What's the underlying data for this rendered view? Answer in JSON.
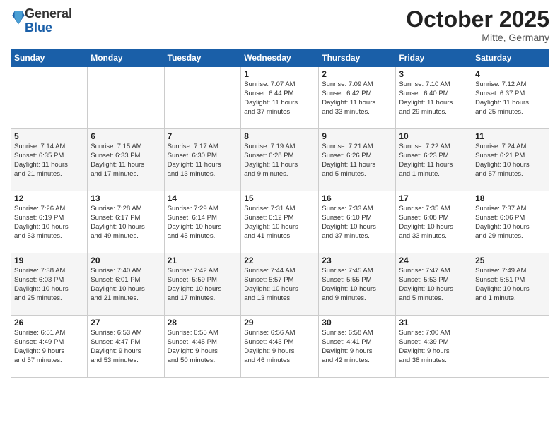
{
  "logo": {
    "general": "General",
    "blue": "Blue"
  },
  "header": {
    "month": "October 2025",
    "location": "Mitte, Germany"
  },
  "weekdays": [
    "Sunday",
    "Monday",
    "Tuesday",
    "Wednesday",
    "Thursday",
    "Friday",
    "Saturday"
  ],
  "weeks": [
    [
      {
        "day": "",
        "info": ""
      },
      {
        "day": "",
        "info": ""
      },
      {
        "day": "",
        "info": ""
      },
      {
        "day": "1",
        "info": "Sunrise: 7:07 AM\nSunset: 6:44 PM\nDaylight: 11 hours\nand 37 minutes."
      },
      {
        "day": "2",
        "info": "Sunrise: 7:09 AM\nSunset: 6:42 PM\nDaylight: 11 hours\nand 33 minutes."
      },
      {
        "day": "3",
        "info": "Sunrise: 7:10 AM\nSunset: 6:40 PM\nDaylight: 11 hours\nand 29 minutes."
      },
      {
        "day": "4",
        "info": "Sunrise: 7:12 AM\nSunset: 6:37 PM\nDaylight: 11 hours\nand 25 minutes."
      }
    ],
    [
      {
        "day": "5",
        "info": "Sunrise: 7:14 AM\nSunset: 6:35 PM\nDaylight: 11 hours\nand 21 minutes."
      },
      {
        "day": "6",
        "info": "Sunrise: 7:15 AM\nSunset: 6:33 PM\nDaylight: 11 hours\nand 17 minutes."
      },
      {
        "day": "7",
        "info": "Sunrise: 7:17 AM\nSunset: 6:30 PM\nDaylight: 11 hours\nand 13 minutes."
      },
      {
        "day": "8",
        "info": "Sunrise: 7:19 AM\nSunset: 6:28 PM\nDaylight: 11 hours\nand 9 minutes."
      },
      {
        "day": "9",
        "info": "Sunrise: 7:21 AM\nSunset: 6:26 PM\nDaylight: 11 hours\nand 5 minutes."
      },
      {
        "day": "10",
        "info": "Sunrise: 7:22 AM\nSunset: 6:23 PM\nDaylight: 11 hours\nand 1 minute."
      },
      {
        "day": "11",
        "info": "Sunrise: 7:24 AM\nSunset: 6:21 PM\nDaylight: 10 hours\nand 57 minutes."
      }
    ],
    [
      {
        "day": "12",
        "info": "Sunrise: 7:26 AM\nSunset: 6:19 PM\nDaylight: 10 hours\nand 53 minutes."
      },
      {
        "day": "13",
        "info": "Sunrise: 7:28 AM\nSunset: 6:17 PM\nDaylight: 10 hours\nand 49 minutes."
      },
      {
        "day": "14",
        "info": "Sunrise: 7:29 AM\nSunset: 6:14 PM\nDaylight: 10 hours\nand 45 minutes."
      },
      {
        "day": "15",
        "info": "Sunrise: 7:31 AM\nSunset: 6:12 PM\nDaylight: 10 hours\nand 41 minutes."
      },
      {
        "day": "16",
        "info": "Sunrise: 7:33 AM\nSunset: 6:10 PM\nDaylight: 10 hours\nand 37 minutes."
      },
      {
        "day": "17",
        "info": "Sunrise: 7:35 AM\nSunset: 6:08 PM\nDaylight: 10 hours\nand 33 minutes."
      },
      {
        "day": "18",
        "info": "Sunrise: 7:37 AM\nSunset: 6:06 PM\nDaylight: 10 hours\nand 29 minutes."
      }
    ],
    [
      {
        "day": "19",
        "info": "Sunrise: 7:38 AM\nSunset: 6:03 PM\nDaylight: 10 hours\nand 25 minutes."
      },
      {
        "day": "20",
        "info": "Sunrise: 7:40 AM\nSunset: 6:01 PM\nDaylight: 10 hours\nand 21 minutes."
      },
      {
        "day": "21",
        "info": "Sunrise: 7:42 AM\nSunset: 5:59 PM\nDaylight: 10 hours\nand 17 minutes."
      },
      {
        "day": "22",
        "info": "Sunrise: 7:44 AM\nSunset: 5:57 PM\nDaylight: 10 hours\nand 13 minutes."
      },
      {
        "day": "23",
        "info": "Sunrise: 7:45 AM\nSunset: 5:55 PM\nDaylight: 10 hours\nand 9 minutes."
      },
      {
        "day": "24",
        "info": "Sunrise: 7:47 AM\nSunset: 5:53 PM\nDaylight: 10 hours\nand 5 minutes."
      },
      {
        "day": "25",
        "info": "Sunrise: 7:49 AM\nSunset: 5:51 PM\nDaylight: 10 hours\nand 1 minute."
      }
    ],
    [
      {
        "day": "26",
        "info": "Sunrise: 6:51 AM\nSunset: 4:49 PM\nDaylight: 9 hours\nand 57 minutes."
      },
      {
        "day": "27",
        "info": "Sunrise: 6:53 AM\nSunset: 4:47 PM\nDaylight: 9 hours\nand 53 minutes."
      },
      {
        "day": "28",
        "info": "Sunrise: 6:55 AM\nSunset: 4:45 PM\nDaylight: 9 hours\nand 50 minutes."
      },
      {
        "day": "29",
        "info": "Sunrise: 6:56 AM\nSunset: 4:43 PM\nDaylight: 9 hours\nand 46 minutes."
      },
      {
        "day": "30",
        "info": "Sunrise: 6:58 AM\nSunset: 4:41 PM\nDaylight: 9 hours\nand 42 minutes."
      },
      {
        "day": "31",
        "info": "Sunrise: 7:00 AM\nSunset: 4:39 PM\nDaylight: 9 hours\nand 38 minutes."
      },
      {
        "day": "",
        "info": ""
      }
    ]
  ]
}
